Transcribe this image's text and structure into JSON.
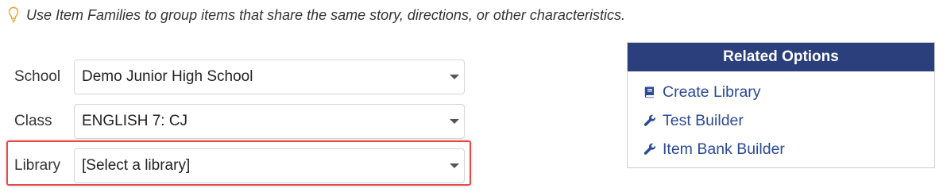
{
  "tip": {
    "text": "Use Item Families to group items that share the same story, directions, or other characteristics.",
    "icon": "lightbulb-icon",
    "icon_color": "#f0a030"
  },
  "form": {
    "school": {
      "label": "School",
      "value": "Demo Junior High School"
    },
    "class": {
      "label": "Class",
      "value": "ENGLISH 7: CJ"
    },
    "library": {
      "label": "Library",
      "value": "[Select a library]"
    }
  },
  "related": {
    "title": "Related Options",
    "header_color": "#2b3f7c",
    "link_color": "#2b4a94",
    "items": [
      {
        "label": "Create Library",
        "icon": "book-icon"
      },
      {
        "label": "Test Builder",
        "icon": "wrench-icon"
      },
      {
        "label": "Item Bank Builder",
        "icon": "wrench-icon"
      }
    ]
  },
  "highlight_color": "#e24b4b"
}
